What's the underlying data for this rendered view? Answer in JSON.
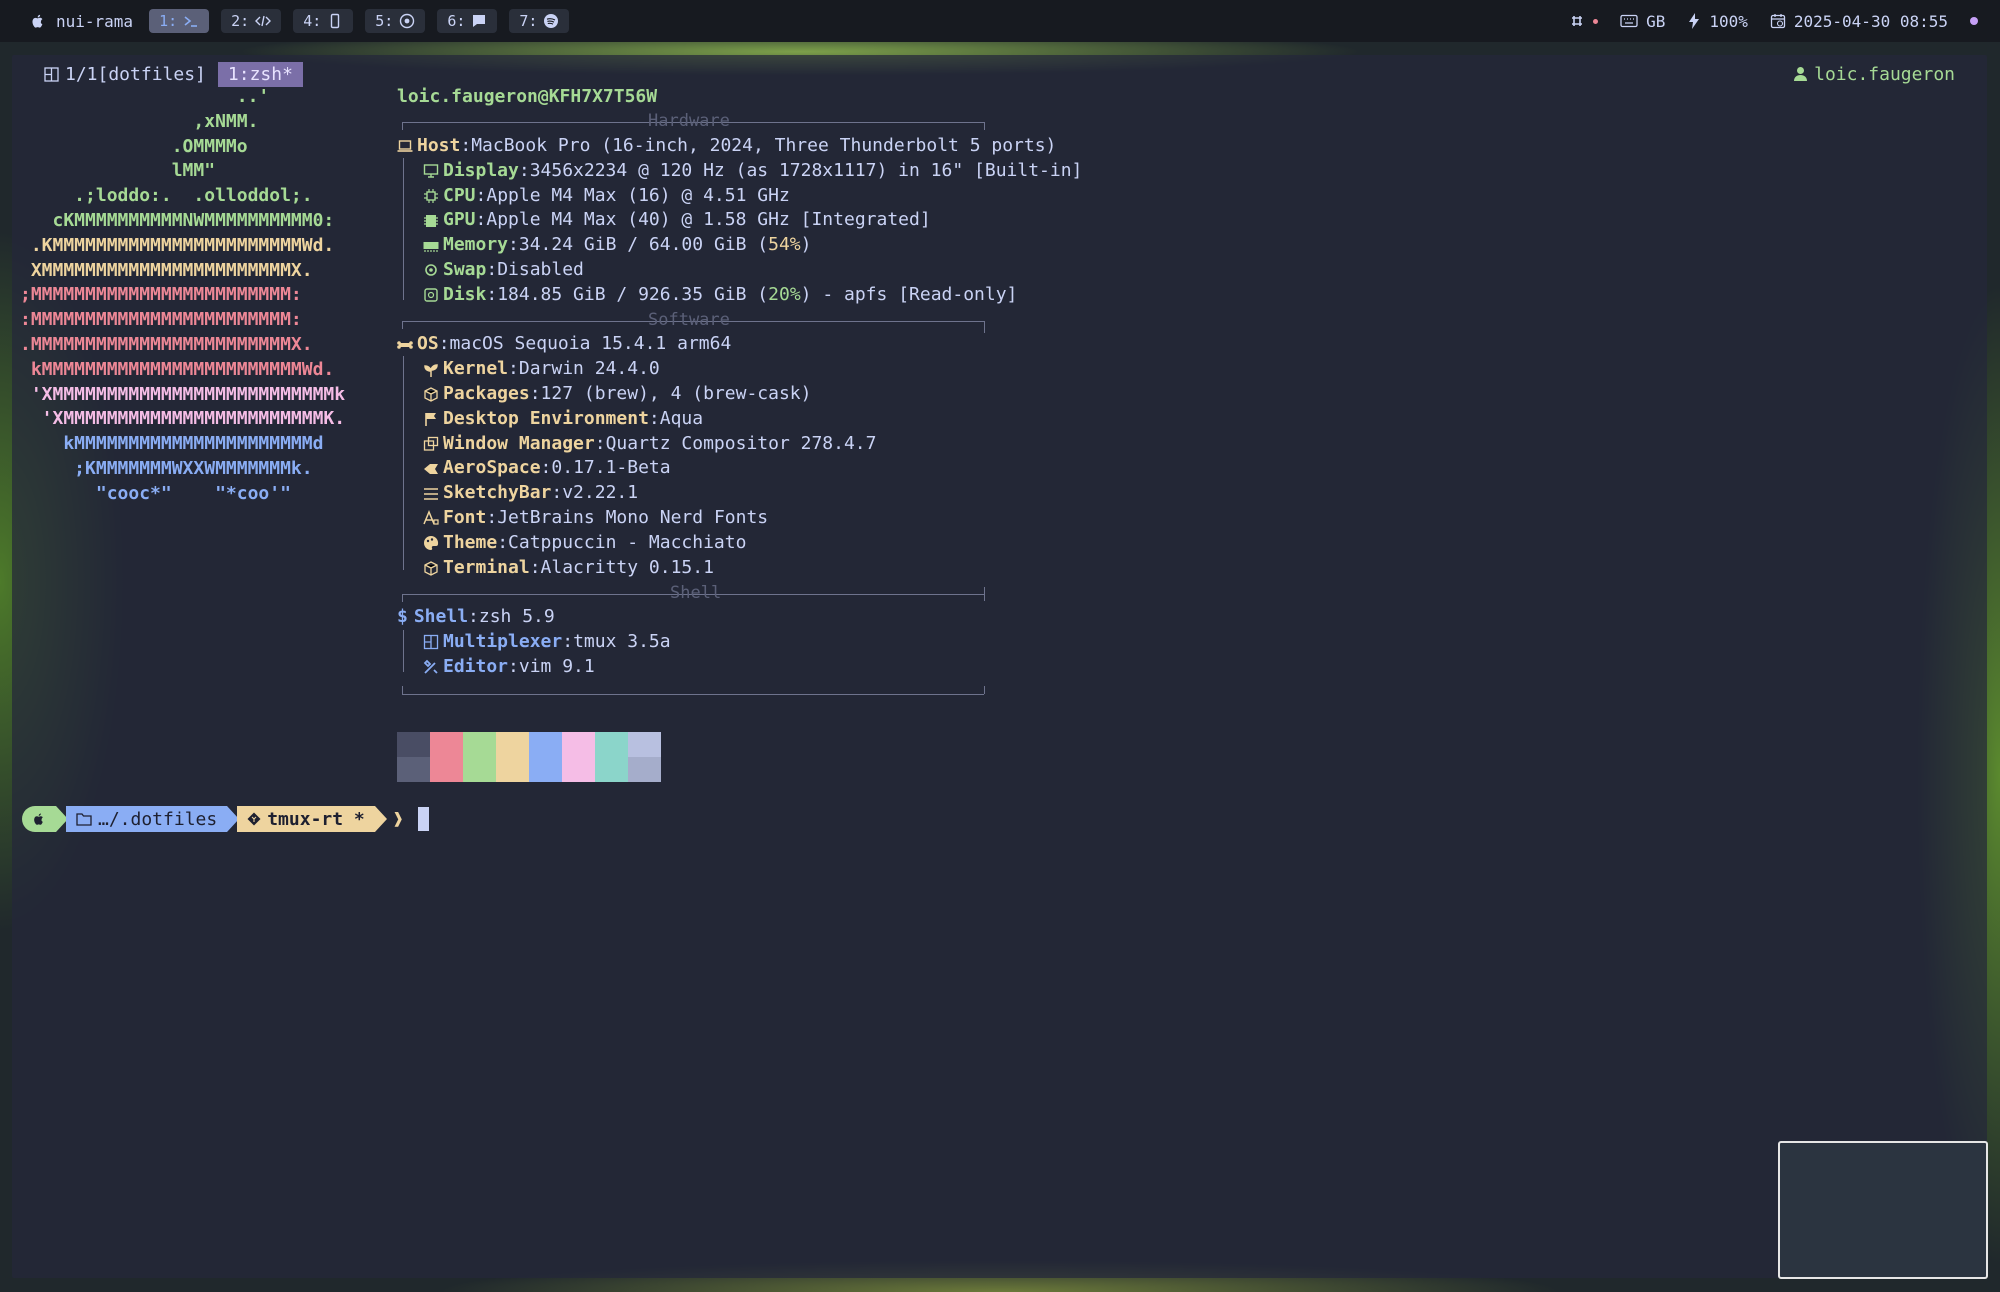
{
  "menubar": {
    "host": "nui-rama",
    "workspaces": [
      {
        "label": "1:",
        "icon": "terminal-icon",
        "active": true
      },
      {
        "label": "2:",
        "icon": "code-icon"
      },
      {
        "label": "4:",
        "icon": "phone-icon"
      },
      {
        "label": "5:",
        "icon": "chrome-icon"
      },
      {
        "label": "6:",
        "icon": "chat-icon"
      },
      {
        "label": "7:",
        "icon": "spotify-icon"
      }
    ],
    "keyboard": "GB",
    "battery": "100%",
    "datetime": "2025-04-30 08:55"
  },
  "tmux": {
    "session": "1/1[dotfiles]",
    "window": "1:zsh*",
    "user": "loic.faugeron"
  },
  "logo": [
    {
      "text": "                    ..'",
      "color": "g"
    },
    {
      "text": "                ,xNMM.",
      "color": "g"
    },
    {
      "text": "              .OMMMMo",
      "color": "g"
    },
    {
      "text": "              lMM\"",
      "color": "g"
    },
    {
      "text": "     .;loddo:.  .olloddol;.",
      "color": "g"
    },
    {
      "text": "   cKMMMMMMMMMMNWMMMMMMMMMM0:",
      "color": "g"
    },
    {
      "text": " .KMMMMMMMMMMMMMMMMMMMMMMMWd.",
      "color": "y"
    },
    {
      "text": " XMMMMMMMMMMMMMMMMMMMMMMMX.",
      "color": "y"
    },
    {
      "text": ";MMMMMMMMMMMMMMMMMMMMMMMM:",
      "color": "r"
    },
    {
      "text": ":MMMMMMMMMMMMMMMMMMMMMMMM:",
      "color": "r"
    },
    {
      "text": ".MMMMMMMMMMMMMMMMMMMMMMMMX.",
      "color": "r"
    },
    {
      "text": " kMMMMMMMMMMMMMMMMMMMMMMMMWd.",
      "color": "r"
    },
    {
      "text": " 'XMMMMMMMMMMMMMMMMMMMMMMMMMMk",
      "color": "m"
    },
    {
      "text": "  'XMMMMMMMMMMMMMMMMMMMMMMMMK.",
      "color": "m"
    },
    {
      "text": "    kMMMMMMMMMMMMMMMMMMMMMMd",
      "color": "b"
    },
    {
      "text": "     ;KMMMMMMMWXXWMMMMMMMk.",
      "color": "b"
    },
    {
      "text": "       \"cooc*\"    \"*coo'\"",
      "color": "b"
    }
  ],
  "title": "loic.faugeron@KFH7X7T56W",
  "sections": {
    "hardware": "Hardware",
    "software": "Software",
    "shell": "Shell"
  },
  "hardware": {
    "host_key": "Host",
    "host_val": "MacBook Pro (16-inch, 2024, Three Thunderbolt 5 ports)",
    "display_key": "Display",
    "display_val": "3456x2234 @ 120 Hz (as 1728x1117) in 16\" [Built-in]",
    "cpu_key": "CPU",
    "cpu_val": "Apple M4 Max (16) @ 4.51 GHz",
    "gpu_key": "GPU",
    "gpu_val": "Apple M4 Max (40) @ 1.58 GHz [Integrated]",
    "memory_key": "Memory",
    "memory_val": "34.24 GiB / 64.00 GiB (",
    "memory_pct": "54%",
    "memory_end": ")",
    "swap_key": "Swap",
    "swap_val": "Disabled",
    "disk_key": "Disk",
    "disk_val": "184.85 GiB / 926.35 GiB (",
    "disk_pct": "20%",
    "disk_end": ") - apfs [Read-only]"
  },
  "software": {
    "os_key": "OS",
    "os_val": "macOS Sequoia 15.4.1 arm64",
    "kernel_key": "Kernel",
    "kernel_val": "Darwin 24.4.0",
    "packages_key": "Packages",
    "packages_val": "127 (brew), 4 (brew-cask)",
    "de_key": "Desktop Environment",
    "de_val": "Aqua",
    "wm_key": "Window Manager",
    "wm_val": "Quartz Compositor 278.4.7",
    "aero_key": "AeroSpace",
    "aero_val": "0.17.1-Beta",
    "sketchy_key": "SketchyBar",
    "sketchy_val": "v2.22.1",
    "font_key": "Font",
    "font_val": "JetBrains Mono Nerd Fonts",
    "theme_key": "Theme",
    "theme_val": "Catppuccin - Macchiato",
    "terminal_key": "Terminal",
    "terminal_val": "Alacritty 0.15.1"
  },
  "shell": {
    "shell_key": "Shell",
    "shell_val": "zsh 5.9",
    "mux_key": "Multiplexer",
    "mux_val": "tmux 3.5a",
    "editor_key": "Editor",
    "editor_val": "vim 9.1"
  },
  "palette": [
    {
      "top": "#494d64",
      "bottom": "#5b6078"
    },
    {
      "top": "#ed8796",
      "bottom": "#ed8796"
    },
    {
      "top": "#a6da95",
      "bottom": "#a6da95"
    },
    {
      "top": "#eed49f",
      "bottom": "#eed49f"
    },
    {
      "top": "#8aadf4",
      "bottom": "#8aadf4"
    },
    {
      "top": "#f5bde6",
      "bottom": "#f5bde6"
    },
    {
      "top": "#8bd5ca",
      "bottom": "#8bd5ca"
    },
    {
      "top": "#b8c0e0",
      "bottom": "#a5adcb"
    }
  ],
  "prompt": {
    "path": "…/.dotfiles",
    "branch": "tmux-rt *",
    "caret": "❱"
  }
}
